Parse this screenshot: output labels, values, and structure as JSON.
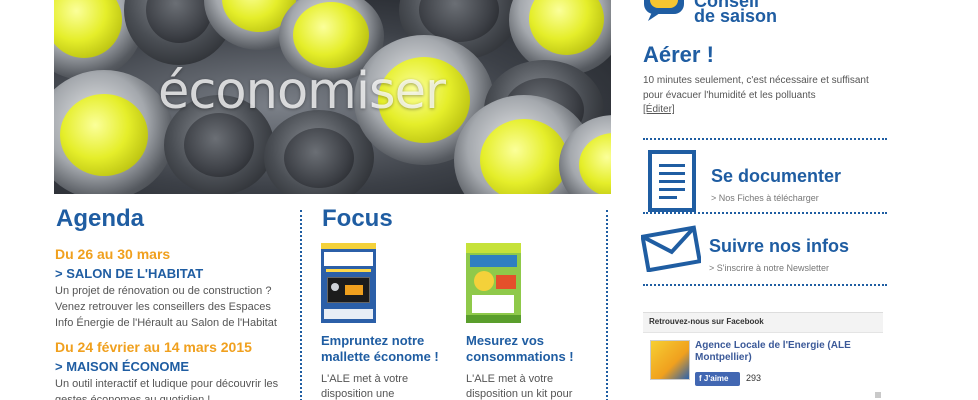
{
  "hero": {
    "word": "économiser"
  },
  "agenda": {
    "title": "Agenda",
    "events": [
      {
        "date": "Du 26 au 30 mars",
        "name": "> SALON DE L'HABITAT",
        "description": "Un projet de rénovation ou de construction ? Venez retrouver les conseillers des Espaces Info Énergie de l'Hérault au Salon de l'Habitat"
      },
      {
        "date": "Du 24 février au 14 mars 2015",
        "name": "> MAISON ÉCONOME",
        "description": "Un outil interactif et ludique pour découvrir les gestes économes au quotidien !"
      }
    ]
  },
  "focus": {
    "title": "Focus",
    "cards": [
      {
        "title": "Empruntez notre mallette économe !",
        "text": "L'ALE met à votre disposition une mallette"
      },
      {
        "title": "Mesurez vos consommations !",
        "text": "L'ALE met à votre disposition un kit pour"
      }
    ]
  },
  "sidebar": {
    "season_top": "Conseil",
    "season_label": "de saison",
    "title": "Aérer !",
    "text": "10 minutes seulement, c'est nécessaire et suffisant pour évacuer l'humidité et les polluants",
    "edit_link": "[Éditer]",
    "blocks": [
      {
        "title": "Se documenter",
        "subtitle": "> Nos Fiches à télécharger",
        "icon": "document-icon"
      },
      {
        "title": "Suivre nos infos",
        "subtitle": "> S'inscrire à notre Newsletter",
        "icon": "envelope-icon"
      }
    ],
    "facebook": {
      "heading": "Retrouvez-nous sur Facebook",
      "page_name": "Agence Locale de l'Energie (ALE Montpellier)",
      "like_label": "J'aime",
      "like_count": "293"
    }
  },
  "colors": {
    "brand_blue": "#1f5da2",
    "accent_orange": "#f0a01e"
  }
}
